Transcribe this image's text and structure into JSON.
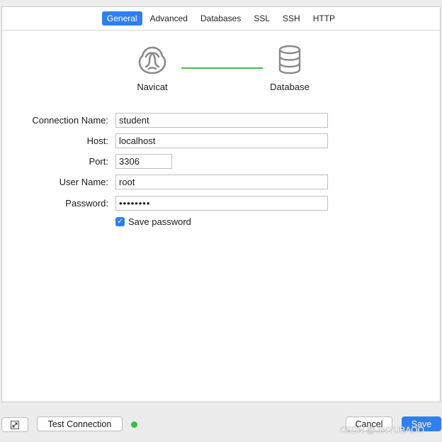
{
  "tabs": [
    {
      "label": "General",
      "active": true
    },
    {
      "label": "Advanced",
      "active": false
    },
    {
      "label": "Databases",
      "active": false
    },
    {
      "label": "SSL",
      "active": false
    },
    {
      "label": "SSH",
      "active": false
    },
    {
      "label": "HTTP",
      "active": false
    }
  ],
  "diagram": {
    "source_label": "Navicat",
    "target_label": "Database",
    "source_icon": "navicat-logo-icon",
    "target_icon": "database-icon",
    "connector_color": "#3ec24a"
  },
  "form": {
    "connection_name": {
      "label": "Connection Name:",
      "value": "student"
    },
    "host": {
      "label": "Host:",
      "value": "localhost"
    },
    "port": {
      "label": "Port:",
      "value": "3306"
    },
    "user_name": {
      "label": "User Name:",
      "value": "root"
    },
    "password": {
      "label": "Password:",
      "value": "••••••••"
    },
    "save_password": {
      "label": "Save password",
      "checked": true
    }
  },
  "footer": {
    "expand_icon": "expand-icon",
    "test_connection_label": "Test Connection",
    "status_color": "#2fc244",
    "cancel_label": "Cancel",
    "save_label": "Save",
    "watermark": "CSDN @JINYUBAOO"
  },
  "colors": {
    "accent": "#2f80ed"
  }
}
